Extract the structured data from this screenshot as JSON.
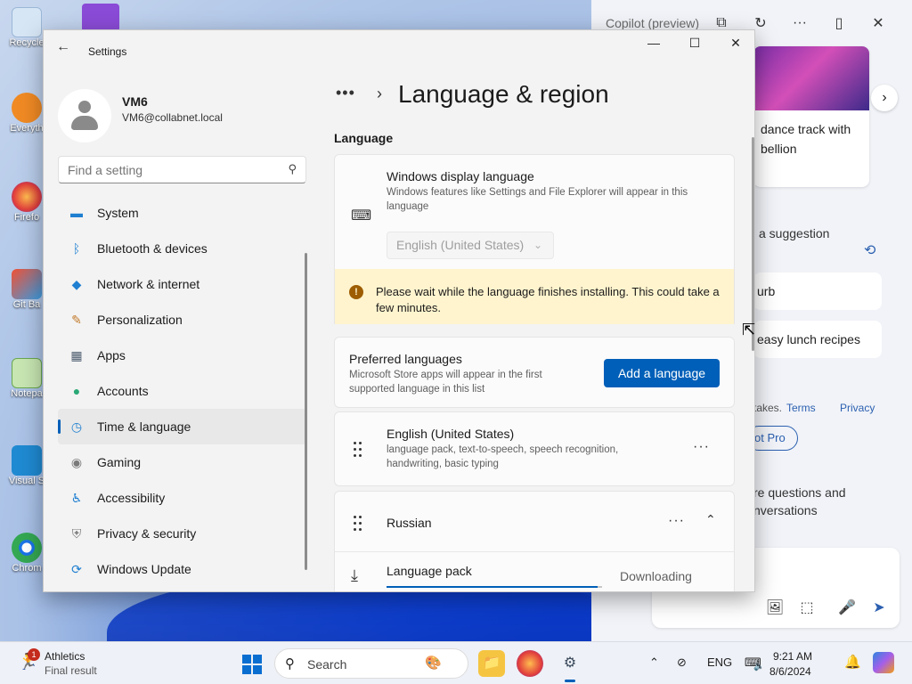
{
  "desktop": {
    "icons": [
      {
        "label": "Recycle"
      },
      {
        "label": "Everyth"
      },
      {
        "label": "Firefo"
      },
      {
        "label": "Git Ba"
      },
      {
        "label": "Notepa"
      },
      {
        "label": "Visual S"
      },
      {
        "label": "Chrom"
      }
    ]
  },
  "copilot": {
    "title": "Copilot (preview)",
    "card_text": "dance track with bellion",
    "suggestion_label": "a suggestion",
    "pill1": "urb",
    "pill2": "easy lunch recipes",
    "terms_prefix": "takes.",
    "terms": "Terms",
    "privacy": "Privacy",
    "pro_btn": "ot Pro",
    "more_q_line1": "re questions and",
    "more_q_line2": "nversations"
  },
  "settings": {
    "window_title": "Settings",
    "user": {
      "name": "VM6",
      "email": "VM6@collabnet.local"
    },
    "search_placeholder": "Find a setting",
    "nav": [
      {
        "label": "System",
        "icon": "monitor-icon",
        "color": "#1f7fd1"
      },
      {
        "label": "Bluetooth & devices",
        "icon": "bluetooth-icon",
        "color": "#1f7fd1"
      },
      {
        "label": "Network & internet",
        "icon": "wifi-icon",
        "color": "#1f7fd1"
      },
      {
        "label": "Personalization",
        "icon": "brush-icon",
        "color": "#c27a2b"
      },
      {
        "label": "Apps",
        "icon": "apps-icon",
        "color": "#4a5a6d"
      },
      {
        "label": "Accounts",
        "icon": "person-icon",
        "color": "#2aa876"
      },
      {
        "label": "Time & language",
        "icon": "globe-clock-icon",
        "color": "#1f7fd1"
      },
      {
        "label": "Gaming",
        "icon": "gamepad-icon",
        "color": "#7a7a7a"
      },
      {
        "label": "Accessibility",
        "icon": "accessibility-icon",
        "color": "#1f7fd1"
      },
      {
        "label": "Privacy & security",
        "icon": "shield-icon",
        "color": "#7a7a7a"
      },
      {
        "label": "Windows Update",
        "icon": "update-icon",
        "color": "#1f7fd1"
      }
    ],
    "active_nav": "Time & language",
    "page_title": "Language & region",
    "section_title": "Language",
    "display_language": {
      "title": "Windows display language",
      "desc": "Windows features like Settings and File Explorer will appear in this language",
      "value": "English (United States)"
    },
    "warning": "Please wait while the language finishes installing. This could take a few minutes.",
    "preferred": {
      "title": "Preferred languages",
      "desc": "Microsoft Store apps will appear in the first supported language in this list",
      "button": "Add a language"
    },
    "languages": [
      {
        "name": "English (United States)",
        "features": "language pack, text-to-speech, speech recognition, handwriting, basic typing"
      },
      {
        "name": "Russian"
      }
    ],
    "language_pack": {
      "label": "Language pack",
      "status": "Downloading",
      "progress": 0.98
    }
  },
  "taskbar": {
    "news_title": "Athletics",
    "news_sub": "Final result",
    "news_badge": "1",
    "search_label": "Search",
    "lang": "ENG",
    "time": "9:21 AM",
    "date": "8/6/2024"
  }
}
